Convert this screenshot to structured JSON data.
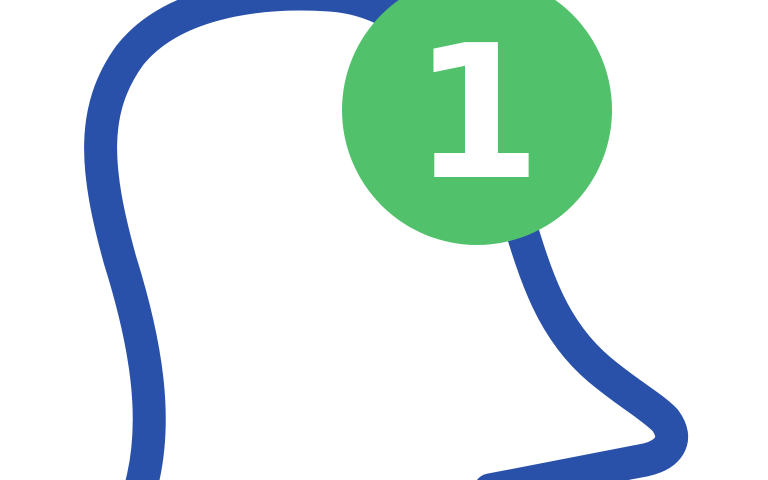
{
  "notification": {
    "icon": "bell-icon",
    "badge_count": "1",
    "outline_color": "#2a51a9",
    "badge_color": "#52c16b",
    "badge_text_color": "#ffffff"
  }
}
